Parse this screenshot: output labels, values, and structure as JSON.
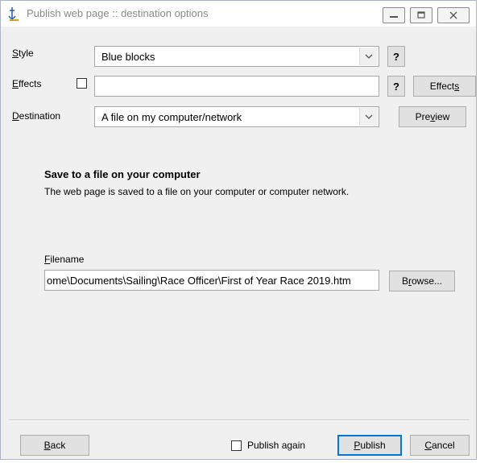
{
  "window": {
    "title": "Publish web page :: destination options"
  },
  "form": {
    "style": {
      "label_prefix": "",
      "label_accel": "S",
      "label_rest": "tyle",
      "value": "Blue blocks",
      "help": "?"
    },
    "effects": {
      "label_accel": "E",
      "label_rest": "ffects",
      "value": "",
      "help": "?",
      "button_prefix": "Effect",
      "button_accel": "s",
      "button_rest": ""
    },
    "destination": {
      "label_accel": "D",
      "label_rest": "estination",
      "value": "A file on my computer/network",
      "preview_prefix": "Pre",
      "preview_accel": "v",
      "preview_rest": "iew"
    }
  },
  "info": {
    "heading": "Save to a file on your computer",
    "description": "The web page is saved to a file on your computer or computer network."
  },
  "filename": {
    "label_accel": "F",
    "label_rest": "ilename",
    "value": "ome\\Documents\\Sailing\\Race Officer\\First of Year Race 2019.htm",
    "browse_prefix": "B",
    "browse_accel": "r",
    "browse_rest": "owse..."
  },
  "footer": {
    "back_accel": "B",
    "back_rest": "ack",
    "publish_again_label": "Publish again",
    "publish_accel": "P",
    "publish_rest": "ublish",
    "cancel_accel": "C",
    "cancel_rest": "ancel"
  },
  "icons": {
    "app": "anchor-icon",
    "minimize": "minimize-icon",
    "maximize": "maximize-icon",
    "close": "close-icon",
    "dropdown": "chevron-down-icon"
  }
}
